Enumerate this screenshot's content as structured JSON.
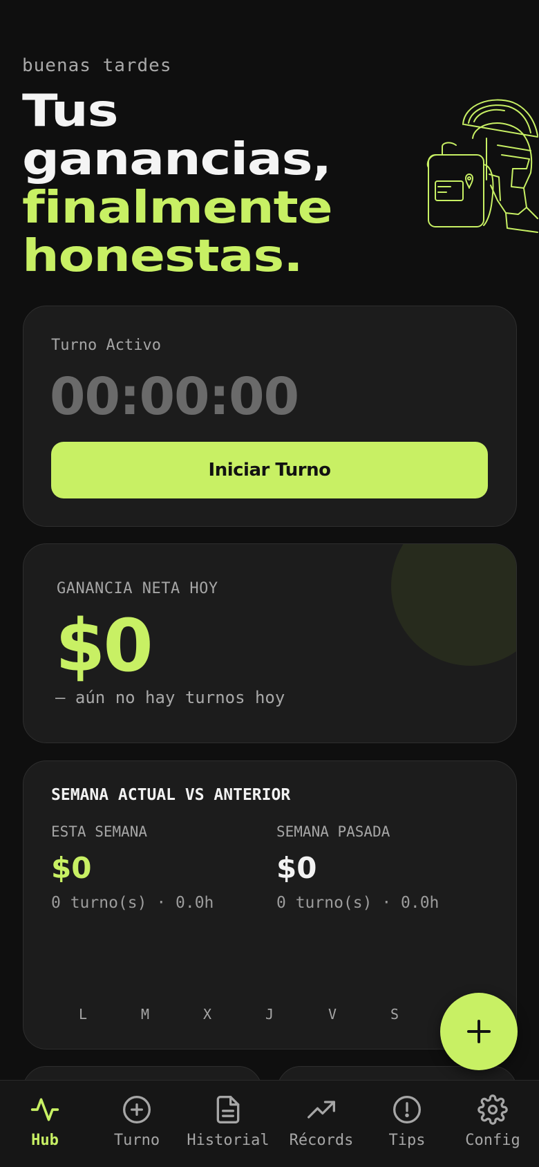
{
  "greeting": "buenas tardes",
  "hero": {
    "line1": "Tus",
    "line2": "ganancias,",
    "line3": "finalmente",
    "line4": "honestas."
  },
  "shift": {
    "label": "Turno Activo",
    "timer": "00:00:00",
    "button": "Iniciar Turno"
  },
  "net_today": {
    "label": "GANANCIA NETA HOY",
    "value": "$0",
    "note": "— aún no hay turnos hoy"
  },
  "week": {
    "title": "SEMANA ACTUAL VS ANTERIOR",
    "current": {
      "label": "ESTA SEMANA",
      "value": "$0",
      "detail": "0 turno(s) · 0.0h"
    },
    "previous": {
      "label": "SEMANA PASADA",
      "value": "$0",
      "detail": "0 turno(s) · 0.0h"
    },
    "days": [
      "L",
      "M",
      "X",
      "J",
      "V",
      "S"
    ]
  },
  "nav": [
    {
      "label": "Hub",
      "icon": "activity-icon",
      "active": true
    },
    {
      "label": "Turno",
      "icon": "plus-circle-icon"
    },
    {
      "label": "Historial",
      "icon": "document-icon"
    },
    {
      "label": "Récords",
      "icon": "trending-up-icon"
    },
    {
      "label": "Tips",
      "icon": "alert-circle-icon"
    },
    {
      "label": "Config",
      "icon": "gear-icon"
    }
  ],
  "colors": {
    "accent": "#c8f064",
    "background": "#0f0f0f",
    "card": "#1c1c1c"
  }
}
